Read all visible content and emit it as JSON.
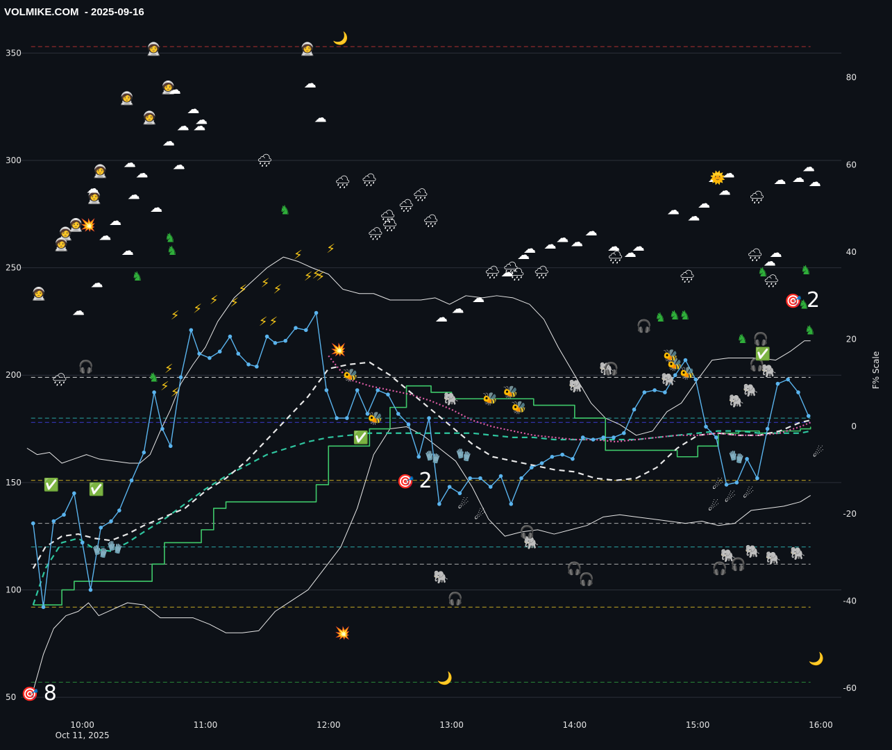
{
  "header": {
    "title": "VOLMIKE.COM  - 2025-09-16"
  },
  "chart_data": {
    "type": "line",
    "title": "VOLMIKE.COM  - 2025-09-16",
    "ylabel_right": "F% Scale",
    "xlabel": "",
    "x_date_label": "Oct 11, 2025",
    "x_ticks": [
      "10:00",
      "11:00",
      "12:00",
      "13:00",
      "14:00",
      "15:00",
      "16:00"
    ],
    "x_range": [
      "09:30",
      "16:10"
    ],
    "y_left_ticks": [
      50,
      100,
      150,
      200,
      250,
      300,
      350
    ],
    "y_left_range": [
      40,
      365
    ],
    "y_right_ticks": [
      80,
      60,
      40,
      20,
      0,
      -20,
      -40,
      -60
    ],
    "y_right_range": [
      -67,
      93
    ],
    "grid": "horizontal",
    "colors": {
      "price": "#5ab4ee",
      "band": "#e8e8e8",
      "green": "#3fca6b",
      "teal": "#2fc6a0",
      "pink": "#e05ca6",
      "red": "#e03a3a",
      "purple": "#9b2fc9",
      "yellow": "#c8a923"
    },
    "ref_lines": [
      {
        "y": 353,
        "color": "#b03030"
      },
      {
        "y": 199,
        "color": "#d8d8d8"
      },
      {
        "y": 180,
        "color": "#2aa6a6"
      },
      {
        "y": 178,
        "color": "#3a3ad0"
      },
      {
        "y": 151,
        "color": "#c8a923"
      },
      {
        "y": 131,
        "color": "#aaaaaa"
      },
      {
        "y": 120,
        "color": "#2aa6a6"
      },
      {
        "y": 112,
        "color": "#aaaaaa"
      },
      {
        "y": 92,
        "color": "#c8a923"
      },
      {
        "y": 57,
        "color": "#2a8a3a"
      }
    ],
    "series": [
      {
        "key": "price",
        "x": [
          "09:36",
          "09:41",
          "09:46",
          "09:51",
          "09:56",
          "10:00",
          "10:04",
          "10:09",
          "10:14",
          "10:18",
          "10:24",
          "10:30",
          "10:35",
          "10:39",
          "10:43",
          "10:48",
          "10:53",
          "10:57",
          "11:02",
          "11:07",
          "11:12",
          "11:16",
          "11:21",
          "11:25",
          "11:30",
          "11:34",
          "11:39",
          "11:44",
          "11:49",
          "11:54",
          "11:59",
          "12:04",
          "12:09",
          "12:14",
          "12:19",
          "12:24",
          "12:29",
          "12:34",
          "12:39",
          "12:44",
          "12:49",
          "12:54",
          "12:59",
          "13:04",
          "13:09",
          "13:14",
          "13:19",
          "13:24",
          "13:29",
          "13:34",
          "13:39",
          "13:44",
          "13:49",
          "13:54",
          "13:59",
          "14:04",
          "14:09",
          "14:14",
          "14:19",
          "14:24",
          "14:29",
          "14:34",
          "14:39",
          "14:44",
          "14:49",
          "14:54",
          "14:59",
          "15:04",
          "15:09",
          "15:14",
          "15:19",
          "15:24",
          "15:29",
          "15:34",
          "15:39",
          "15:44",
          "15:49",
          "15:54"
        ],
        "values": [
          131,
          92,
          132,
          135,
          145,
          122,
          100,
          129,
          132,
          137,
          151,
          164,
          192,
          175,
          167,
          199,
          221,
          210,
          208,
          211,
          218,
          210,
          205,
          204,
          218,
          215,
          216,
          222,
          221,
          229,
          193,
          180,
          180,
          193,
          182,
          193,
          191,
          182,
          177,
          162,
          180,
          140,
          148,
          145,
          152,
          152,
          148,
          153,
          140,
          152,
          157,
          159,
          162,
          163,
          161,
          171,
          170,
          171,
          171,
          173,
          184,
          192,
          193,
          192,
          200,
          207,
          198,
          176,
          171,
          149,
          150,
          161,
          152,
          175,
          196,
          198,
          192,
          181
        ]
      },
      {
        "key": "upper_band",
        "x": [
          "09:33",
          "09:38",
          "09:44",
          "09:50",
          "09:56",
          "10:02",
          "10:08",
          "10:15",
          "10:23",
          "10:28",
          "10:33",
          "10:38",
          "10:43",
          "10:48",
          "10:54",
          "11:00",
          "11:06",
          "11:14",
          "11:22",
          "11:30",
          "11:38",
          "11:45",
          "11:52",
          "12:00",
          "12:07",
          "12:15",
          "12:22",
          "12:30",
          "12:38",
          "12:45",
          "12:52",
          "12:59",
          "13:07",
          "13:15",
          "13:22",
          "13:30",
          "13:38",
          "13:45",
          "13:52",
          "14:00",
          "14:08",
          "14:15",
          "14:22",
          "14:30",
          "14:38",
          "14:45",
          "14:52",
          "15:00",
          "15:07",
          "15:15",
          "15:22",
          "15:30",
          "15:38",
          "15:45",
          "15:52",
          "15:55"
        ],
        "values": [
          166,
          163,
          164,
          159,
          161,
          163,
          161,
          160,
          159,
          159,
          163,
          174,
          184,
          196,
          205,
          213,
          225,
          236,
          243,
          250,
          255,
          253,
          250,
          247,
          240,
          238,
          238,
          235,
          235,
          235,
          236,
          233,
          237,
          236,
          237,
          236,
          233,
          226,
          213,
          200,
          187,
          180,
          177,
          172,
          174,
          183,
          187,
          198,
          207,
          208,
          208,
          208,
          207,
          211,
          216,
          216
        ]
      },
      {
        "key": "lower_band",
        "x": [
          "09:36",
          "09:41",
          "09:46",
          "09:52",
          "09:58",
          "10:03",
          "10:08",
          "10:15",
          "10:22",
          "10:30",
          "10:38",
          "10:46",
          "10:54",
          "11:02",
          "11:10",
          "11:18",
          "11:26",
          "11:34",
          "11:42",
          "11:50",
          "11:58",
          "12:06",
          "12:14",
          "12:22",
          "12:30",
          "12:38",
          "12:46",
          "12:54",
          "13:02",
          "13:10",
          "13:18",
          "13:26",
          "13:34",
          "13:42",
          "13:50",
          "13:58",
          "14:06",
          "14:14",
          "14:22",
          "14:30",
          "14:38",
          "14:46",
          "14:54",
          "15:02",
          "15:10",
          "15:18",
          "15:26",
          "15:34",
          "15:42",
          "15:50",
          "15:55"
        ],
        "values": [
          53,
          70,
          82,
          88,
          90,
          94,
          88,
          91,
          94,
          93,
          87,
          87,
          87,
          84,
          80,
          80,
          81,
          90,
          95,
          100,
          110,
          120,
          138,
          163,
          175,
          176,
          172,
          166,
          160,
          148,
          133,
          125,
          127,
          128,
          126,
          128,
          130,
          134,
          135,
          134,
          133,
          132,
          131,
          132,
          130,
          131,
          137,
          138,
          139,
          141,
          144
        ]
      },
      {
        "key": "white_dashed",
        "x": [
          "09:36",
          "09:42",
          "09:50",
          "09:58",
          "10:06",
          "10:14",
          "10:22",
          "10:30",
          "10:40",
          "10:50",
          "11:00",
          "11:10",
          "11:20",
          "11:30",
          "11:40",
          "11:50",
          "12:00",
          "12:10",
          "12:20",
          "12:30",
          "12:40",
          "12:50",
          "13:00",
          "13:10",
          "13:20",
          "13:30",
          "13:40",
          "13:50",
          "14:00",
          "14:10",
          "14:20",
          "14:30",
          "14:40",
          "14:50",
          "15:00",
          "15:10",
          "15:20",
          "15:30",
          "15:40",
          "15:50",
          "15:55"
        ],
        "values": [
          110,
          120,
          125,
          126,
          124,
          123,
          126,
          130,
          134,
          138,
          146,
          152,
          160,
          170,
          180,
          190,
          203,
          205,
          206,
          200,
          192,
          184,
          176,
          168,
          162,
          160,
          158,
          156,
          155,
          152,
          151,
          152,
          157,
          166,
          172,
          173,
          172,
          172,
          174,
          178,
          179
        ]
      },
      {
        "key": "teal_dashed",
        "x": [
          "09:36",
          "09:42",
          "09:50",
          "09:58",
          "10:06",
          "10:14",
          "10:22",
          "10:30",
          "10:40",
          "10:50",
          "11:00",
          "11:10",
          "11:20",
          "11:30",
          "11:40",
          "11:50",
          "12:00",
          "12:10",
          "12:20",
          "12:30",
          "12:40",
          "12:50",
          "13:00",
          "13:10",
          "13:20",
          "13:30",
          "13:40",
          "13:50",
          "14:00",
          "14:10",
          "14:20",
          "14:30",
          "14:40",
          "14:50",
          "15:00",
          "15:10",
          "15:20",
          "15:30",
          "15:40",
          "15:50",
          "15:55"
        ],
        "values": [
          93,
          110,
          122,
          124,
          119,
          118,
          122,
          127,
          133,
          140,
          147,
          153,
          158,
          163,
          166,
          169,
          171,
          172,
          173,
          173,
          173,
          173,
          173,
          173,
          172,
          171,
          171,
          170,
          170,
          170,
          170,
          170,
          171,
          172,
          173,
          174,
          174,
          173,
          173,
          173,
          174
        ]
      },
      {
        "key": "pink_dotted",
        "x": [
          "12:00",
          "12:05",
          "12:10",
          "12:20",
          "12:30",
          "12:40",
          "12:50",
          "13:00",
          "13:10",
          "13:20",
          "13:30",
          "13:40",
          "13:50",
          "14:00",
          "14:10",
          "14:20",
          "14:30",
          "14:40",
          "14:50",
          "15:00",
          "15:10",
          "15:20",
          "15:30",
          "15:40",
          "15:50",
          "15:55"
        ],
        "values": [
          209,
          203,
          198,
          195,
          193,
          191,
          188,
          184,
          179,
          176,
          174,
          172,
          171,
          170,
          170,
          169,
          170,
          171,
          172,
          172,
          173,
          172,
          172,
          173,
          176,
          178
        ]
      },
      {
        "key": "green_step",
        "x": [
          "09:36",
          "09:42",
          "09:50",
          "09:56",
          "10:00",
          "10:10",
          "10:20",
          "10:28",
          "10:34",
          "10:40",
          "10:50",
          "10:58",
          "11:04",
          "11:10",
          "11:20",
          "11:30",
          "11:40",
          "11:48",
          "11:54",
          "12:00",
          "12:10",
          "12:20",
          "12:30",
          "12:38",
          "12:45",
          "12:50",
          "13:00",
          "13:20",
          "13:40",
          "14:00",
          "14:10",
          "14:15",
          "14:20",
          "14:30",
          "14:40",
          "14:50",
          "15:00",
          "15:10",
          "15:20",
          "15:30",
          "15:40",
          "15:50",
          "15:55"
        ],
        "values": [
          93,
          93,
          100,
          104,
          104,
          104,
          104,
          104,
          112,
          122,
          122,
          128,
          138,
          141,
          141,
          141,
          141,
          141,
          149,
          167,
          167,
          175,
          185,
          195,
          195,
          192,
          189,
          189,
          186,
          180,
          180,
          165,
          165,
          165,
          165,
          162,
          167,
          173,
          174,
          173,
          174,
          175,
          176
        ]
      }
    ],
    "annotations": [
      {
        "label": "2",
        "x": "12:38",
        "y": 151
      },
      {
        "label": "2",
        "x": "15:47",
        "y": 235
      },
      {
        "label": "8",
        "x": "09:35",
        "y": 52
      }
    ]
  },
  "icons": {
    "astronaut": "🧑‍🚀",
    "cloud": "☁",
    "rain": "🌧",
    "bolt": "⚡",
    "horse": "♞",
    "target": "🎯",
    "moon": "🌙",
    "sun": "🌞",
    "elephant": "🐘",
    "headphones": "🎧",
    "check": "✅",
    "bee": "🐝",
    "hand": "🧤",
    "comet": "☄",
    "burst": "💥"
  }
}
